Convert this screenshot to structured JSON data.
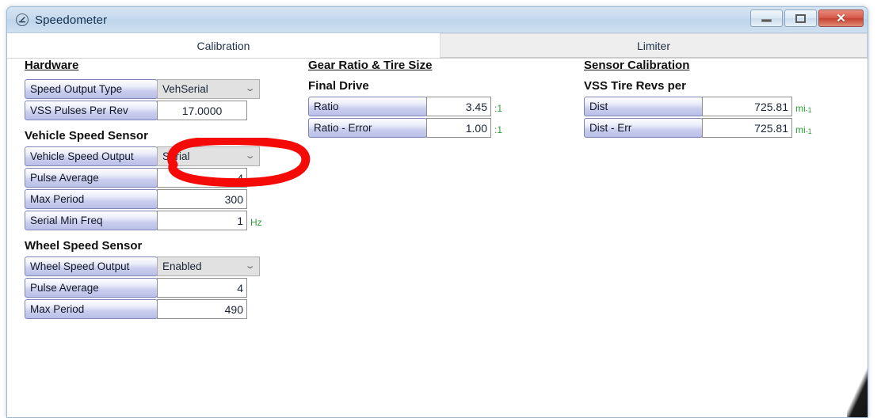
{
  "window": {
    "title": "Speedometer",
    "icon": "speedometer-gauge-icon",
    "buttons": {
      "minimize": "—",
      "maximize": "□",
      "close": "✕"
    }
  },
  "tabs": [
    {
      "label": "Calibration",
      "active": true
    },
    {
      "label": "Limiter",
      "active": false
    }
  ],
  "columns": {
    "left": {
      "group_title": "Hardware",
      "fields": [
        {
          "label": "Speed Output Type",
          "type": "combo",
          "value": "VehSerial",
          "annotated": true
        },
        {
          "label": "VSS Pulses Per Rev",
          "type": "text",
          "value": "17.0000",
          "align": "center"
        }
      ],
      "sections": [
        {
          "title": "Vehicle Speed Sensor",
          "fields": [
            {
              "label": "Vehicle Speed Output",
              "type": "combo",
              "value": "Serial"
            },
            {
              "label": "Pulse Average",
              "type": "text",
              "value": "4"
            },
            {
              "label": "Max Period",
              "type": "text",
              "value": "300"
            },
            {
              "label": "Serial Min Freq",
              "type": "text",
              "value": "1",
              "unit": "Hz"
            }
          ]
        },
        {
          "title": "Wheel Speed Sensor",
          "fields": [
            {
              "label": "Wheel Speed Output",
              "type": "combo",
              "value": "Enabled"
            },
            {
              "label": "Pulse Average",
              "type": "text",
              "value": "4"
            },
            {
              "label": "Max Period",
              "type": "text",
              "value": "490"
            }
          ]
        }
      ]
    },
    "mid": {
      "group_title": "Gear Ratio & Tire Size",
      "sections": [
        {
          "title": "Final Drive",
          "fields": [
            {
              "label": "Ratio",
              "type": "text",
              "value": "3.45",
              "unit": ":1"
            },
            {
              "label": "Ratio - Error",
              "type": "text",
              "value": "1.00",
              "unit": ":1"
            }
          ]
        }
      ]
    },
    "right": {
      "group_title": "Sensor Calibration",
      "sections": [
        {
          "title": "VSS Tire Revs per",
          "fields": [
            {
              "label": "Dist",
              "type": "text",
              "value": "725.81",
              "unit": "mi",
              "unit_sup": "-1"
            },
            {
              "label": "Dist - Err",
              "type": "text",
              "value": "725.81",
              "unit": "mi",
              "unit_sup": "-1"
            }
          ]
        }
      ]
    }
  },
  "annotation": {
    "shape": "hand-drawn-red-ellipse",
    "color": "#f40b08",
    "targets": "Speed Output Type combo box"
  },
  "colors": {
    "titlebar": "#c6daee",
    "label_gradient_top": "#ffffff",
    "label_gradient_bottom": "#b9bfe8",
    "unit_text": "#2f9d3a",
    "close_button": "#c6412f",
    "annotation_red": "#f40b08"
  }
}
